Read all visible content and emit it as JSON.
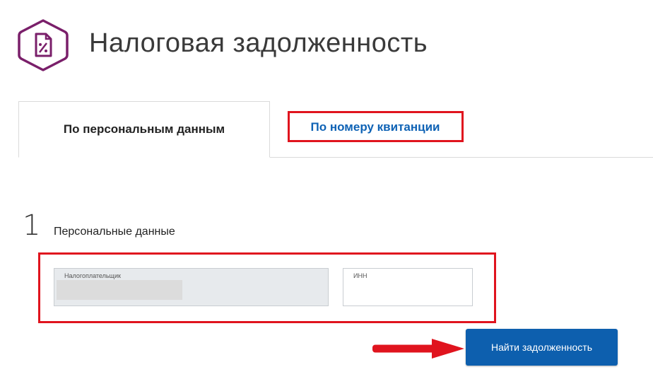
{
  "header": {
    "title": "Налоговая задолженность",
    "icon": "tax-document-percent-icon",
    "icon_color": "#7a1f6a"
  },
  "tabs": [
    {
      "label": "По персональным данным",
      "active": true
    },
    {
      "label": "По номеру квитанции",
      "active": false,
      "highlighted": true
    }
  ],
  "step": {
    "number": "1",
    "label": "Персональные данные"
  },
  "form": {
    "payer_label": "Налогоплательщик",
    "payer_value": "",
    "inn_label": "ИНН",
    "inn_value": ""
  },
  "actions": {
    "find_label": "Найти задолженность"
  },
  "colors": {
    "accent": "#0d5fae",
    "link": "#0e62b5",
    "highlight": "#e0141e",
    "brand": "#7a1f6a"
  }
}
